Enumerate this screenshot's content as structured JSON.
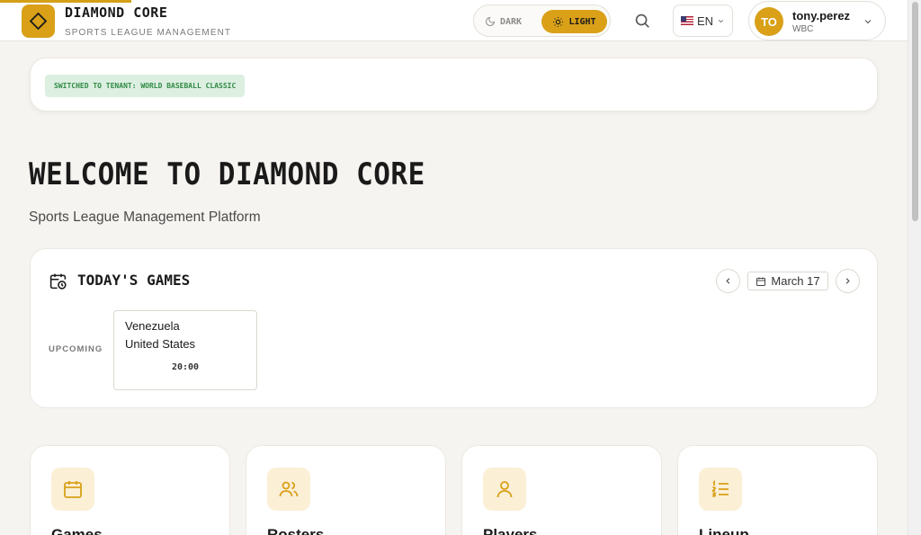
{
  "header": {
    "brand_name": "DIAMOND CORE",
    "brand_sub": "SPORTS LEAGUE MANAGEMENT",
    "theme": {
      "dark_label": "DARK",
      "light_label": "LIGHT",
      "active": "light"
    },
    "language": {
      "code": "EN",
      "icon": "us-flag-icon"
    },
    "user": {
      "initials": "TO",
      "name": "tony.perez",
      "org": "WBC"
    }
  },
  "notice": {
    "text": "SWITCHED TO TENANT: WORLD BASEBALL CLASSIC"
  },
  "main": {
    "title": "WELCOME TO DIAMOND CORE",
    "subtitle": "Sports League Management Platform"
  },
  "todays_games": {
    "title": "TODAY'S GAMES",
    "date": "March 17",
    "groups": [
      {
        "status": "UPCOMING",
        "games": [
          {
            "team1": "Venezuela",
            "team2": "United States",
            "time": "20:00"
          }
        ]
      }
    ]
  },
  "features": [
    {
      "label": "Games",
      "icon": "calendar-icon"
    },
    {
      "label": "Rosters",
      "icon": "users-icon"
    },
    {
      "label": "Players",
      "icon": "user-icon"
    },
    {
      "label": "Lineup",
      "icon": "list-icon"
    }
  ],
  "colors": {
    "accent": "#d9a018",
    "background": "#f6f4f0",
    "badge_bg": "#dcefe1",
    "badge_text": "#2f8a44",
    "icon_tile": "#fbefd6"
  }
}
